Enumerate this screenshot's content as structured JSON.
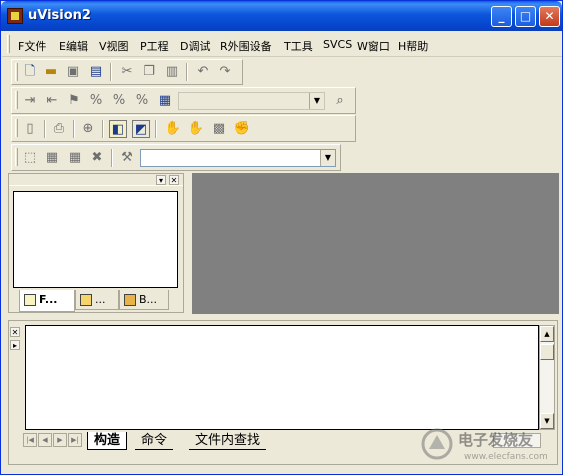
{
  "window": {
    "title": "uVision2"
  },
  "menu": {
    "items": [
      "F文件",
      "E编辑",
      "V视图",
      "P工程",
      "D调试",
      "R外围设备",
      "T工具",
      "SVCS",
      "W窗口",
      "H帮助"
    ]
  },
  "toolbar1": {
    "icons": [
      "new-file-icon",
      "open-folder-icon",
      "save-icon",
      "save-all-icon",
      "cut-icon",
      "copy-icon",
      "paste-icon",
      "undo-icon",
      "redo-icon"
    ]
  },
  "toolbar2": {
    "icons": [
      "indent-icon",
      "outdent-icon",
      "bookmark-icon",
      "prev-bookmark-icon",
      "next-bookmark-icon",
      "clear-bookmarks-icon",
      "find-in-files-icon"
    ],
    "find_combo_value": "",
    "binoculars_icon": "find-icon"
  },
  "toolbar3": {
    "icons": [
      "project-window-icon",
      "print-icon",
      "zoom-icon",
      "window-a-icon",
      "window-b-icon",
      "hand-icon",
      "hand-stop-icon",
      "hand-grid-icon",
      "hand-grab-icon"
    ]
  },
  "toolbar4": {
    "icons": [
      "translate-icon",
      "build-icon",
      "rebuild-icon",
      "stop-build-icon",
      "options-icon"
    ],
    "target_combo_value": ""
  },
  "project_panel": {
    "tabs": [
      {
        "label": "F...",
        "icon": "files-tab-icon"
      },
      {
        "label": "...",
        "icon": "regs-tab-icon"
      },
      {
        "label": "B...",
        "icon": "books-tab-icon"
      }
    ]
  },
  "output_panel": {
    "tabs": [
      "构造",
      "命令",
      "文件内查找"
    ],
    "active_tab": "构造"
  },
  "watermark": {
    "main": "电子发烧友",
    "sub": "www.elecfans.com"
  },
  "colors": {
    "titlebar": "#0a5fe6",
    "workspace": "#808080",
    "chrome": "#ece9d8"
  }
}
